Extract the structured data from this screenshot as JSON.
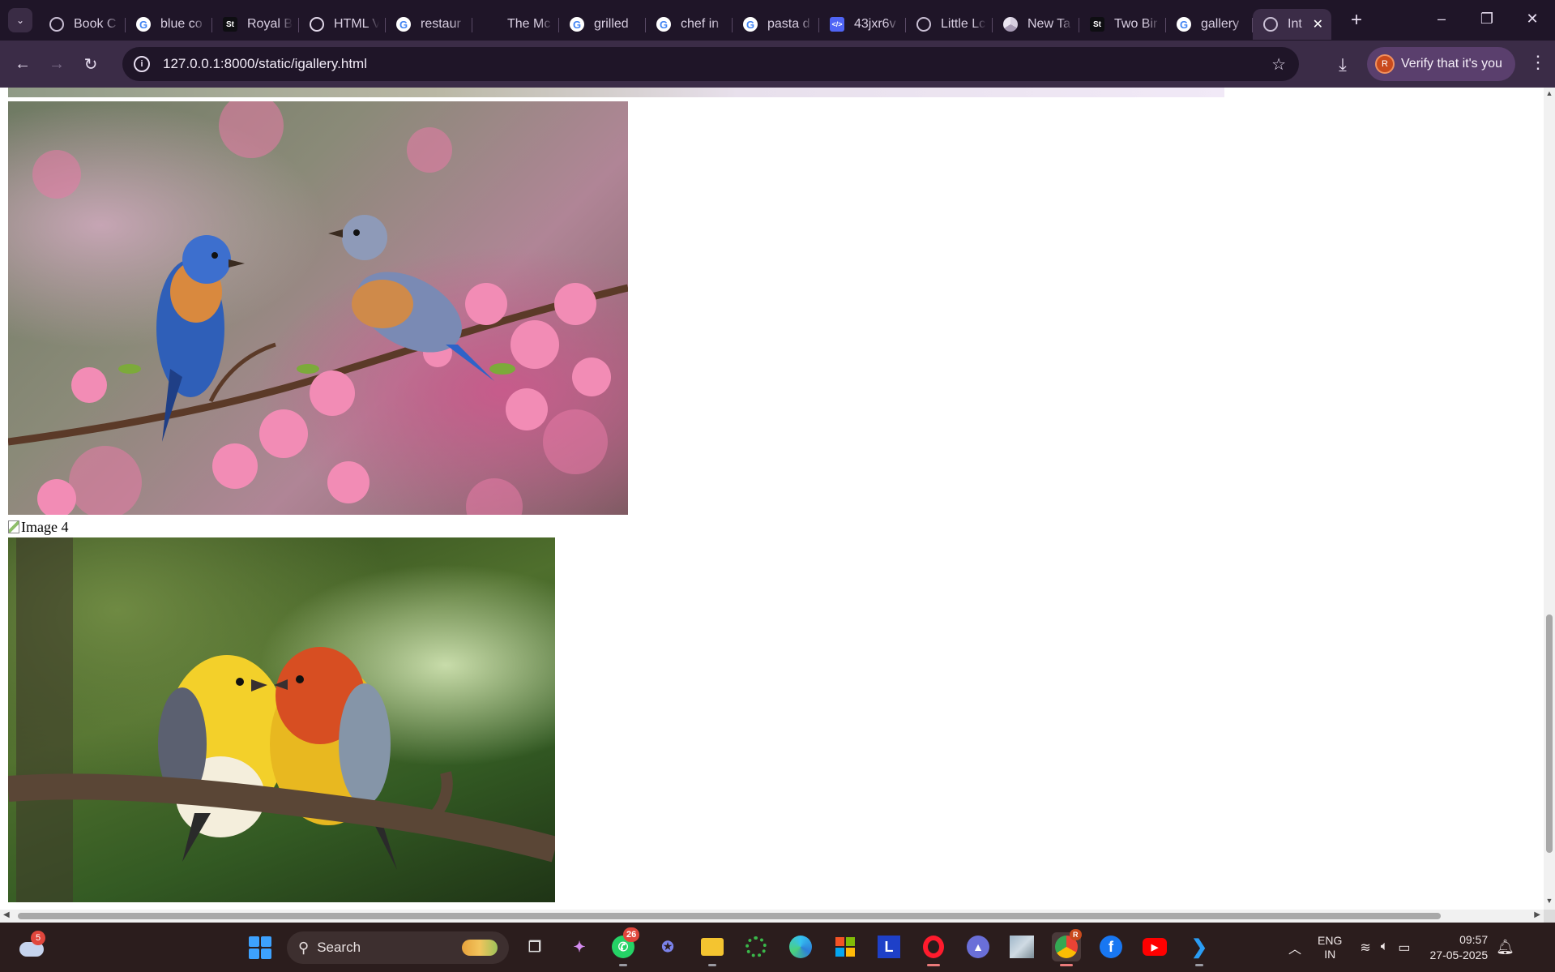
{
  "browser": {
    "tabs": [
      {
        "title": "Book C",
        "favicon": "globe-icon"
      },
      {
        "title": "blue co",
        "favicon": "google-icon"
      },
      {
        "title": "Royal B",
        "favicon": "st-icon"
      },
      {
        "title": "HTML V",
        "favicon": "openai-icon"
      },
      {
        "title": "restaur",
        "favicon": "google-icon"
      },
      {
        "title": "The Mc",
        "favicon": "blank-icon"
      },
      {
        "title": "grilled",
        "favicon": "google-icon"
      },
      {
        "title": "chef in",
        "favicon": "google-icon"
      },
      {
        "title": "pasta d",
        "favicon": "google-icon"
      },
      {
        "title": "43jxr6v",
        "favicon": "code-icon"
      },
      {
        "title": "Little Lc",
        "favicon": "globe-icon"
      },
      {
        "title": "New Ta",
        "favicon": "chrome-icon"
      },
      {
        "title": "Two Bir",
        "favicon": "st-icon"
      },
      {
        "title": "gallery",
        "favicon": "google-icon"
      }
    ],
    "active_tab": {
      "title": "Int",
      "favicon": "globe-icon"
    },
    "address": "127.0.0.1:8000/static/igallery.html",
    "profile_initial": "R",
    "verify_label": "Verify that it's you",
    "st_glyph": "St",
    "code_glyph": "</>"
  },
  "page": {
    "broken_image_alt": "Image 4",
    "images": [
      {
        "name": "two-bluebirds-on-blossom-branch"
      },
      {
        "name": "yellow-and-red-birds-on-branch"
      }
    ]
  },
  "taskbar": {
    "search_placeholder": "Search",
    "weather_badge": "5",
    "whatsapp_badge": "26",
    "chrome_badge": "R",
    "lang_line1": "ENG",
    "lang_line2": "IN",
    "time": "09:57",
    "date": "27-05-2025",
    "letter_app": "L"
  },
  "colors": {
    "tabstrip": "#1f1528",
    "toolbar": "#3b2c47",
    "taskbar": "#2b1d1d",
    "accent": "#3da2ff"
  }
}
